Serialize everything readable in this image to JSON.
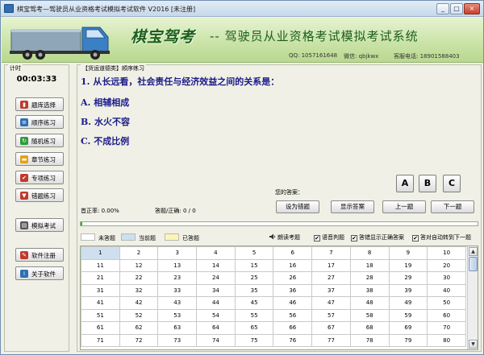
{
  "window": {
    "title": "棋宝驾考—驾驶员从业资格考试模拟考试软件 V2016 [未注册]",
    "minimize": "_",
    "maximize": "□",
    "close": "×"
  },
  "banner": {
    "brand": "棋宝驾考",
    "slogan": "-- 驾驶员从业资格考试模拟考试系统",
    "qq": "QQ: 1057161648",
    "wechat": "微信: qbjkwx",
    "phone": "客服电话: 18901588403"
  },
  "left": {
    "group_label": "计时",
    "timer": "00:03:33",
    "buttons": [
      {
        "label": "题库选择",
        "icon": "book-icon",
        "color": "#c0392b"
      },
      {
        "label": "顺序练习",
        "icon": "list-icon",
        "color": "#2f6fb3"
      },
      {
        "label": "随机练习",
        "icon": "shuffle-icon",
        "color": "#2e9b3a"
      },
      {
        "label": "章节练习",
        "icon": "folder-icon",
        "color": "#e0a21a"
      },
      {
        "label": "专项练习",
        "icon": "check-icon",
        "color": "#c0392b"
      },
      {
        "label": "错题练习",
        "icon": "bookmark-icon",
        "color": "#c0392b"
      },
      {
        "label": "模拟考试",
        "icon": "exam-icon",
        "color": "#555555"
      },
      {
        "label": "软件注册",
        "icon": "pen-icon",
        "color": "#c0392b"
      },
      {
        "label": "关于软件",
        "icon": "info-icon",
        "color": "#2f6fb3"
      }
    ]
  },
  "main": {
    "group_label": "【货运道德类】顺序练习",
    "question": "1. 从长远看，社会责任与经济效益之间的关系是：",
    "options": [
      "A. 相辅相成",
      "B. 水火不容",
      "C. 不成比例"
    ],
    "your_answer_label": "您的答案：",
    "answer_buttons": [
      "A",
      "B",
      "C"
    ],
    "correct_rate": "首正率: 0.00%",
    "answered": "答题/正确: 0 / 0",
    "actions": [
      "设为错题",
      "显示答案",
      "上一题",
      "下一题"
    ],
    "progress": 0.004,
    "legend": [
      {
        "label": "未答题",
        "color": "#ffffff"
      },
      {
        "label": "当前题",
        "color": "#cfdff0"
      },
      {
        "label": "已答题",
        "color": "#fbf6b5"
      }
    ],
    "checks": [
      {
        "label": "朗读考题",
        "checked": false,
        "speaker": true
      },
      {
        "label": "语音判题",
        "checked": true
      },
      {
        "label": "答错显示正确答案",
        "checked": true
      },
      {
        "label": "答对自动转到下一题",
        "checked": true
      }
    ],
    "grid": [
      [
        "1",
        "2",
        "3",
        "4",
        "5",
        "6",
        "7",
        "8",
        "9",
        "10"
      ],
      [
        "11",
        "12",
        "13",
        "14",
        "15",
        "16",
        "17",
        "18",
        "19",
        "20"
      ],
      [
        "21",
        "22",
        "23",
        "24",
        "25",
        "26",
        "27",
        "28",
        "29",
        "30"
      ],
      [
        "31",
        "32",
        "33",
        "34",
        "35",
        "36",
        "37",
        "38",
        "39",
        "40"
      ],
      [
        "41",
        "42",
        "43",
        "44",
        "45",
        "46",
        "47",
        "48",
        "49",
        "50"
      ],
      [
        "51",
        "52",
        "53",
        "54",
        "55",
        "56",
        "57",
        "58",
        "59",
        "60"
      ],
      [
        "61",
        "62",
        "63",
        "64",
        "65",
        "66",
        "67",
        "68",
        "69",
        "70"
      ],
      [
        "71",
        "72",
        "73",
        "74",
        "75",
        "76",
        "77",
        "78",
        "79",
        "80"
      ]
    ],
    "current_question": "1",
    "scroll_up": "▲",
    "scroll_down": "▼"
  }
}
